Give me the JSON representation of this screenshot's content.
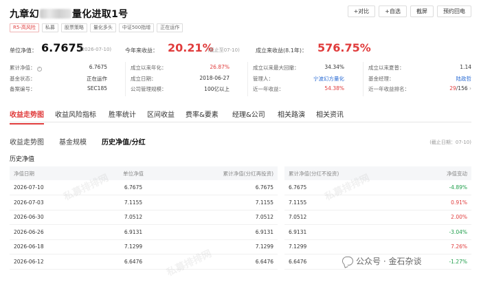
{
  "header": {
    "title_prefix": "九章幻",
    "title_suffix": "量化进取1号",
    "actions": [
      "+对比",
      "+自选",
      "截屏",
      "预约回电"
    ]
  },
  "tags": [
    "R5-高风险",
    "私募",
    "股票策略",
    "量化多头",
    "中证500指增",
    "正在运作"
  ],
  "nav": {
    "unit_nav_label": "单位净值：",
    "unit_nav_value": "6.7675",
    "unit_nav_date": "(2026-07-10)",
    "ytd_label": "今年来收益：",
    "ytd_value": "20.21%",
    "ytd_note": "(截止至07-10)",
    "since_label": "成立来收益(8.1年)：",
    "since_value": "576.75%"
  },
  "info": [
    [
      {
        "label": "累计净值：",
        "value": "6.7675"
      },
      {
        "label": "成立以来年化：",
        "value": "26.87%"
      },
      {
        "label": "成立以来最大回撤：",
        "value": "34.34%"
      },
      {
        "label": "成立以来夏普：",
        "value": "1.14"
      }
    ],
    [
      {
        "label": "基金状态：",
        "value": "正在运作"
      },
      {
        "label": "成立日期：",
        "value": "2018-06-27"
      },
      {
        "label": "管理人：",
        "value": "宁波幻方量化"
      },
      {
        "label": "基金经理：",
        "value": "陆政哲"
      }
    ],
    [
      {
        "label": "备案编号：",
        "value": "SEC185"
      },
      {
        "label": "公司管理规模：",
        "value": "100亿以上"
      },
      {
        "label": "近一年收益：",
        "value": "54.38%"
      },
      {
        "label": "近一年收益排名：",
        "value": "29",
        "value_total": "/156"
      }
    ]
  ],
  "main_tabs": [
    "收益走势图",
    "收益风险指标",
    "胜率统计",
    "区间收益",
    "费率&要素",
    "经理&公司",
    "相关路演",
    "相关资讯"
  ],
  "sub_tabs": [
    "收益走势图",
    "基金规模",
    "历史净值/分红"
  ],
  "as_of": "(截止日期：07-10)",
  "section_title": "历史净值",
  "table_left": {
    "headers": [
      "净值日期",
      "单位净值",
      "累计净值(分红再投资)"
    ],
    "rows": [
      [
        "2026-07-10",
        "6.7675",
        "6.7675"
      ],
      [
        "2026-07-03",
        "7.1155",
        "7.1155"
      ],
      [
        "2026-06-30",
        "7.0512",
        "7.0512"
      ],
      [
        "2026-06-26",
        "6.9131",
        "6.9131"
      ],
      [
        "2026-06-18",
        "7.1299",
        "7.1299"
      ],
      [
        "2026-06-12",
        "6.6476",
        "6.6476"
      ]
    ]
  },
  "table_right": {
    "headers": [
      "累计净值(分红不投资)",
      "净值变动"
    ],
    "rows": [
      [
        "6.7675",
        "-4.89%"
      ],
      [
        "7.1155",
        "0.91%"
      ],
      [
        "7.0512",
        "2.00%"
      ],
      [
        "6.9131",
        "-3.04%"
      ],
      [
        "7.1299",
        "7.26%"
      ],
      [
        "6.6476",
        "-1.27%"
      ]
    ]
  },
  "watermark": "私募排排网",
  "overlay_text": "公众号 · 金石杂谈",
  "colors": {
    "red": "#e03c3c",
    "green": "#1e9e4a",
    "link": "#2b6cd4"
  }
}
